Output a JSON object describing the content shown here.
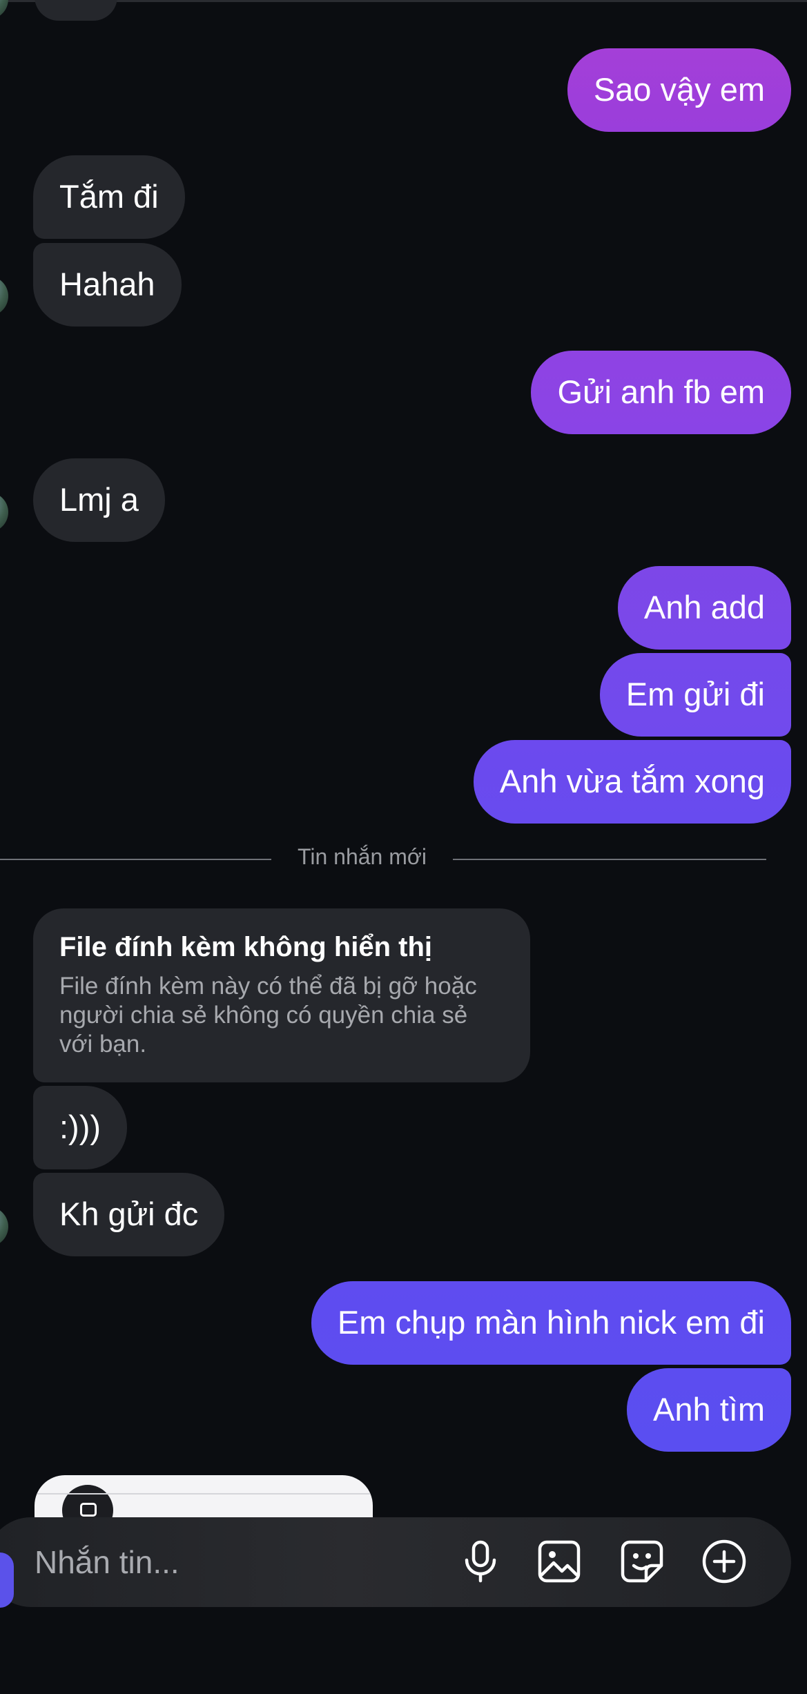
{
  "colors": {
    "background": "#0b0d11",
    "received_bubble": "#25272c",
    "sent_gradient_top": "#a83fd6",
    "sent_gradient_bottom": "#5b4cf0"
  },
  "messages": [
    {
      "side": "sent",
      "text": "Sao vậy em"
    },
    {
      "side": "received",
      "text": "Tắm đi"
    },
    {
      "side": "received",
      "text": "Hahah"
    },
    {
      "side": "sent",
      "text": "Gửi anh fb em"
    },
    {
      "side": "received",
      "text": "Lmj a"
    },
    {
      "side": "sent",
      "text": "Anh add"
    },
    {
      "side": "sent",
      "text": "Em gửi đi"
    },
    {
      "side": "sent",
      "text": "Anh vừa tắm xong"
    },
    {
      "side": "received",
      "text": ":)))"
    },
    {
      "side": "received",
      "text": "Kh gửi đc"
    },
    {
      "side": "sent",
      "text": "Em chụp màn hình nick em đi"
    },
    {
      "side": "sent",
      "text": "Anh tìm"
    }
  ],
  "divider": {
    "label": "Tin nhắn mới"
  },
  "attachment": {
    "title": "File đính kèm không hiển thị",
    "body": "File đính kèm này có thể đã bị gỡ hoặc người chia sẻ không có quyền chia sẻ với bạn."
  },
  "composer": {
    "placeholder": "Nhắn tin...",
    "icons": [
      "microphone-icon",
      "image-icon",
      "sticker-icon",
      "plus-circle-icon"
    ]
  }
}
